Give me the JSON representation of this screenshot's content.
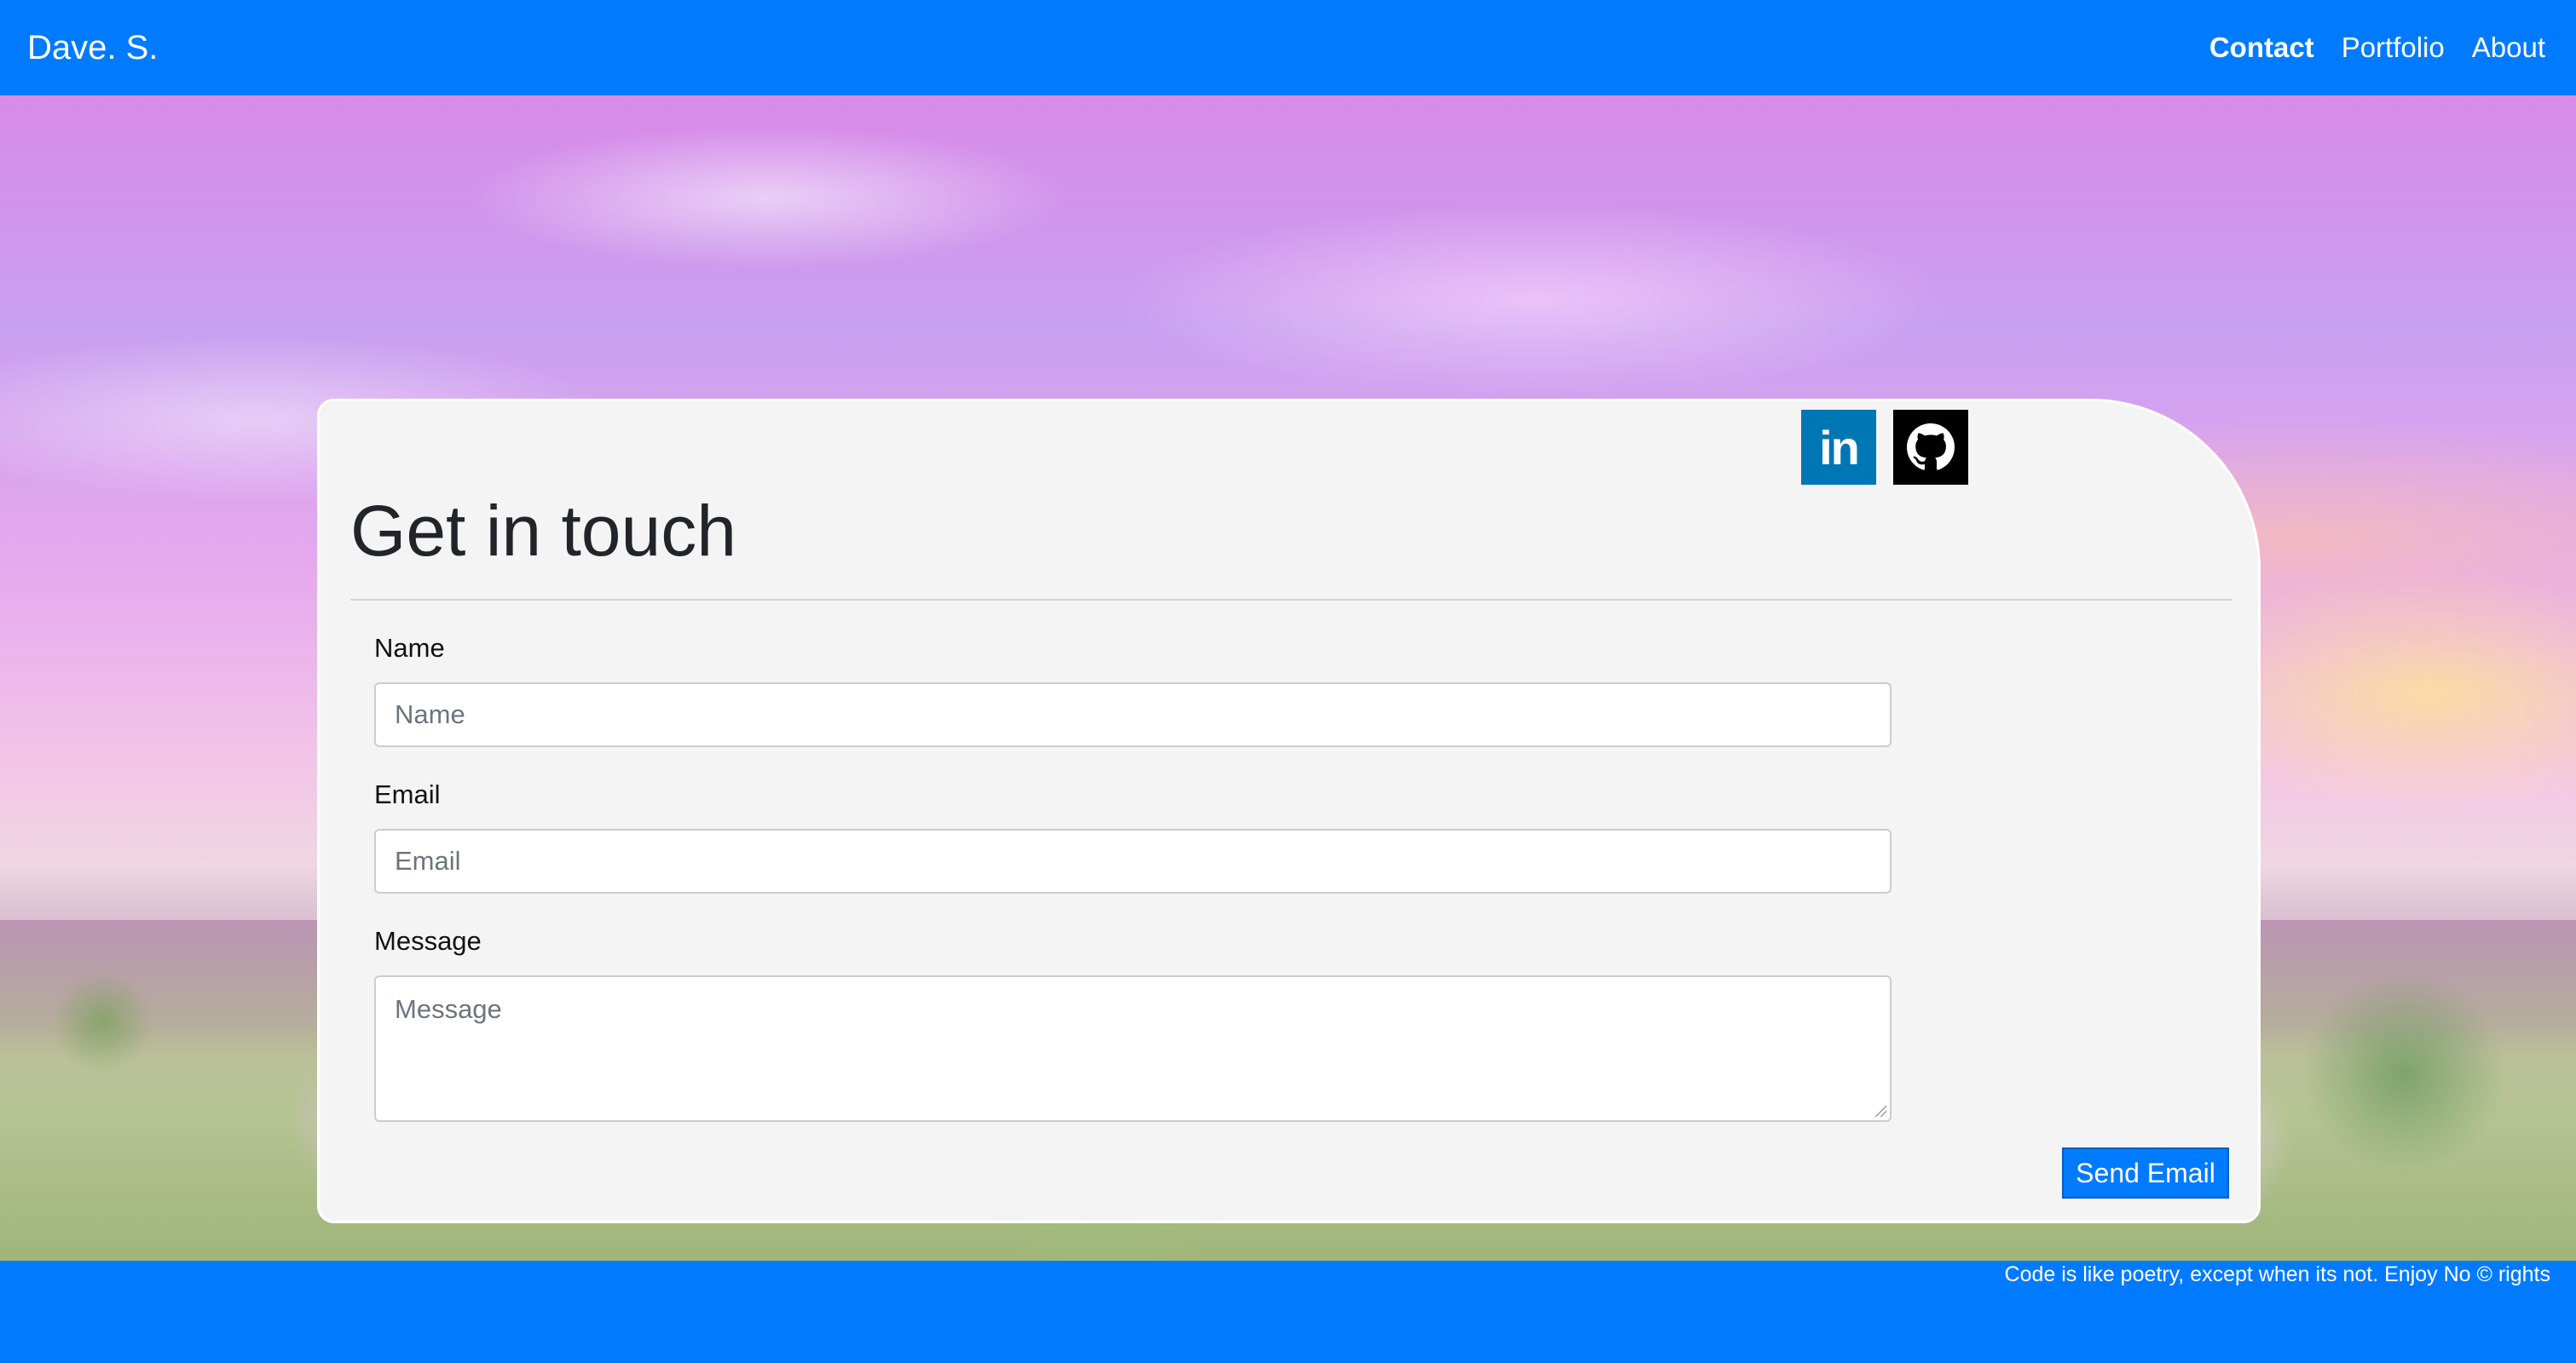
{
  "nav": {
    "brand": "Dave. S.",
    "links": [
      "Contact",
      "Portfolio",
      "About"
    ]
  },
  "card": {
    "title": "Get in touch",
    "social": [
      "linkedin-icon",
      "github-icon"
    ],
    "form": {
      "name_label": "Name",
      "name_placeholder": "Name",
      "email_label": "Email",
      "email_placeholder": "Email",
      "message_label": "Message",
      "message_placeholder": "Message",
      "submit_label": "Send Email"
    }
  },
  "footer": {
    "text": "Code is like poetry, except when its not. Enjoy No © rights"
  },
  "colors": {
    "primary": "#007bff",
    "linkedin": "#0077b5",
    "github": "#000000"
  }
}
